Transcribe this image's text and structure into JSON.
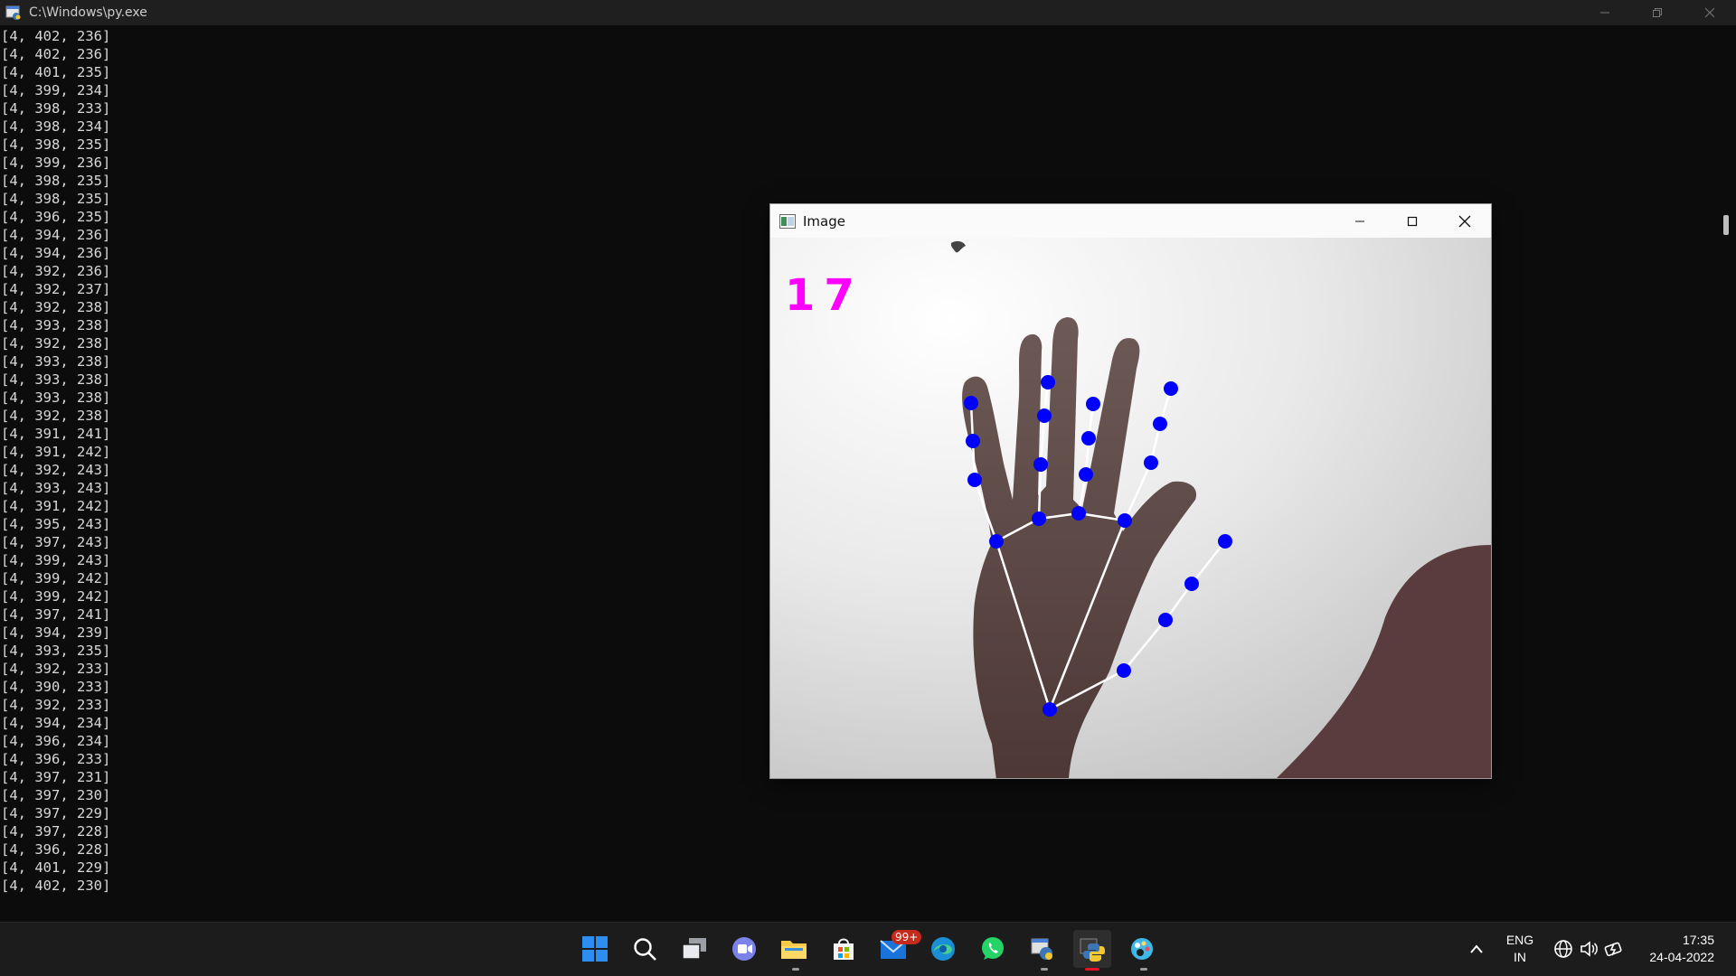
{
  "console": {
    "title": "C:\\Windows\\py.exe",
    "lines": [
      "[4, 402, 236]",
      "[4, 402, 236]",
      "[4, 401, 235]",
      "[4, 399, 234]",
      "[4, 398, 233]",
      "[4, 398, 234]",
      "[4, 398, 235]",
      "[4, 399, 236]",
      "[4, 398, 235]",
      "[4, 398, 235]",
      "[4, 396, 235]",
      "[4, 394, 236]",
      "[4, 394, 236]",
      "[4, 392, 236]",
      "[4, 392, 237]",
      "[4, 392, 238]",
      "[4, 393, 238]",
      "[4, 392, 238]",
      "[4, 393, 238]",
      "[4, 393, 238]",
      "[4, 393, 238]",
      "[4, 392, 238]",
      "[4, 391, 241]",
      "[4, 391, 242]",
      "[4, 392, 243]",
      "[4, 393, 243]",
      "[4, 391, 242]",
      "[4, 395, 243]",
      "[4, 397, 243]",
      "[4, 399, 243]",
      "[4, 399, 242]",
      "[4, 399, 242]",
      "[4, 397, 241]",
      "[4, 394, 239]",
      "[4, 393, 235]",
      "[4, 392, 233]",
      "[4, 390, 233]",
      "[4, 392, 233]",
      "[4, 394, 234]",
      "[4, 396, 234]",
      "[4, 396, 233]",
      "[4, 397, 231]",
      "[4, 397, 230]",
      "[4, 397, 229]",
      "[4, 397, 228]",
      "[4, 396, 228]",
      "[4, 401, 229]",
      "[4, 402, 230]"
    ]
  },
  "image_window": {
    "title": "Image",
    "counter": "17"
  },
  "taskbar": {
    "mail_badge": "99+",
    "language": "ENG",
    "region": "IN",
    "time": "17:35",
    "date": "24-04-2022",
    "apps": [
      "start",
      "search",
      "task-view",
      "teams-chat",
      "file-explorer",
      "microsoft-store",
      "mail",
      "edge",
      "whatsapp",
      "python-launcher",
      "python",
      "paint"
    ]
  },
  "colors": {
    "console_bg": "#0c0c0c",
    "console_text": "#d8d8d8",
    "counter": "#ff00ff",
    "landmark": "#0000ff",
    "connection": "#ffffff"
  }
}
